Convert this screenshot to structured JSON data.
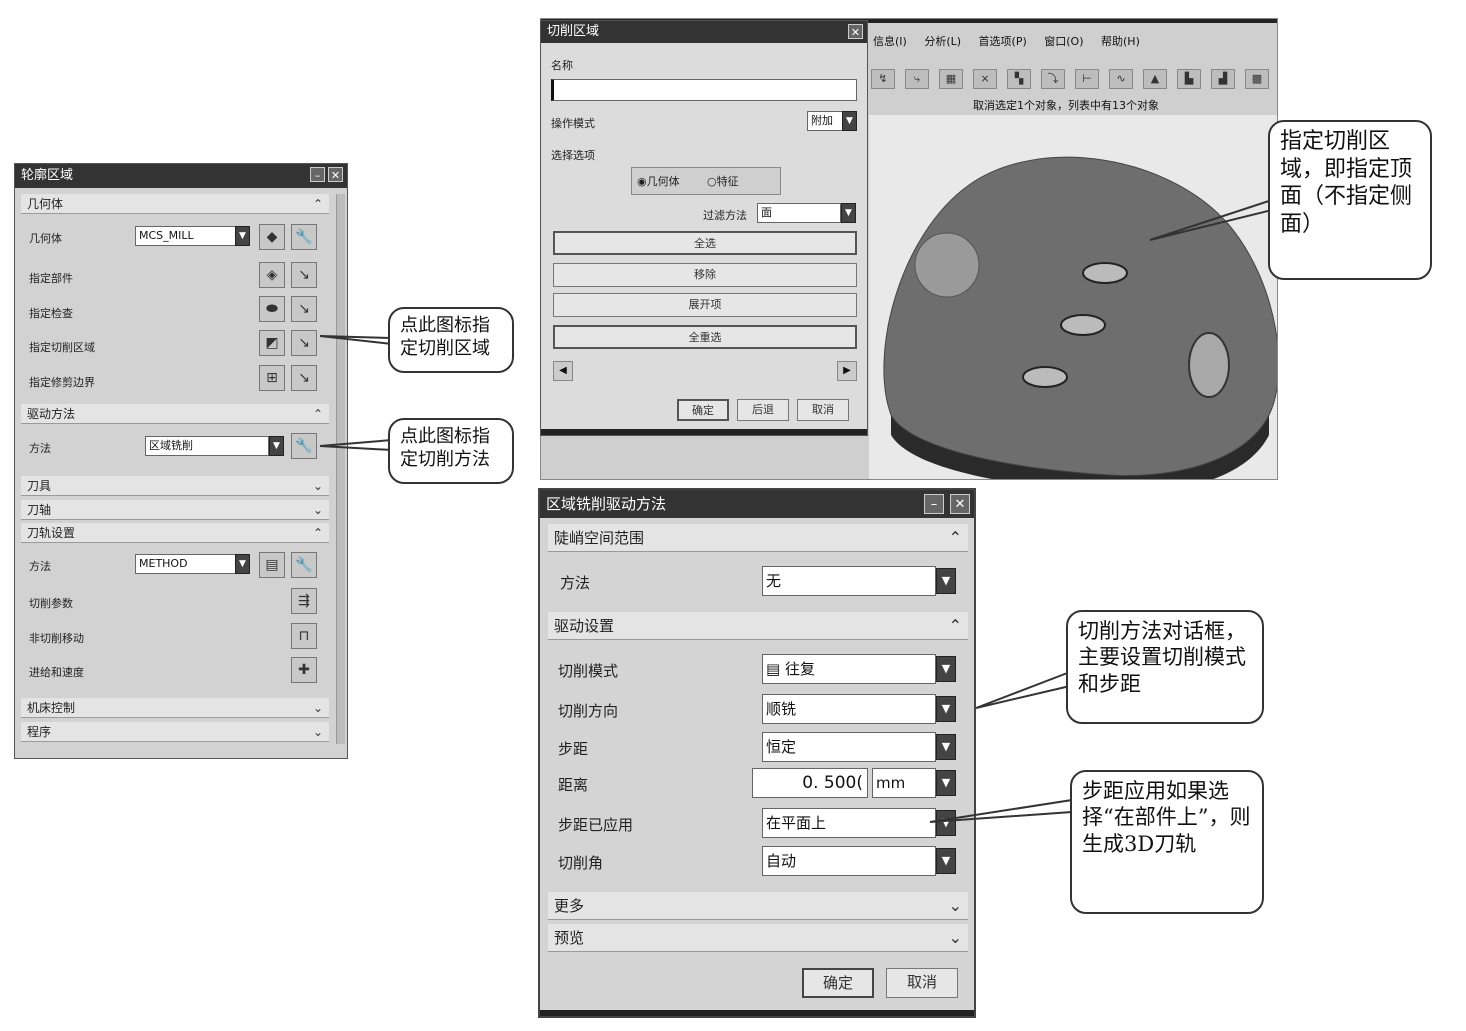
{
  "left_dialog": {
    "title": "轮廓区域",
    "geometry_section": "几何体",
    "geometry_label": "几何体",
    "geometry_value": "MCS_MILL",
    "specify_part": "指定部件",
    "specify_check": "指定检查",
    "specify_cut_area": "指定切削区域",
    "specify_trim": "指定修剪边界",
    "drive_section": "驱动方法",
    "method_label": "方法",
    "method_value": "区域铣削",
    "tool_section": "刀具",
    "axis_section": "刀轴",
    "path_section": "刀轨设置",
    "path_method_label": "方法",
    "path_method_value": "METHOD",
    "cut_params": "切削参数",
    "non_cut_moves": "非切削移动",
    "feeds_speeds": "进给和速度",
    "machine_control": "机床控制",
    "program": "程序"
  },
  "cut_area_dialog": {
    "title": "切削区域",
    "name_label": "名称",
    "name_value": "",
    "op_mode_label": "操作模式",
    "op_mode_value": "附加",
    "select_options_label": "选择选项",
    "radio_geometry": "几何体",
    "radio_feature": "特征",
    "filter_label": "过滤方法",
    "filter_value": "面",
    "btn_select_all": "全选",
    "btn_remove": "移除",
    "btn_expand": "展开项",
    "btn_reselect_all": "全重选",
    "btn_ok": "确定",
    "btn_back": "后退",
    "btn_cancel": "取消"
  },
  "app": {
    "menu": [
      "信息(I)",
      "分析(L)",
      "首选项(P)",
      "窗口(O)",
      "帮助(H)"
    ],
    "status": "取消选定1个对象，列表中有13个对象"
  },
  "drive_dialog": {
    "title": "区域铣削驱动方法",
    "steep_section": "陡峭空间范围",
    "method_label": "方法",
    "method_value": "无",
    "drive_settings_section": "驱动设置",
    "cut_mode_label": "切削模式",
    "cut_mode_value": "往复",
    "cut_dir_label": "切削方向",
    "cut_dir_value": "顺铣",
    "stepover_label": "步距",
    "stepover_value": "恒定",
    "distance_label": "距离",
    "distance_value": "0. 500(",
    "distance_unit": "mm",
    "step_applied_label": "步距已应用",
    "step_applied_value": "在平面上",
    "cut_angle_label": "切削角",
    "cut_angle_value": "自动",
    "more_section": "更多",
    "preview_section": "预览",
    "btn_ok": "确定",
    "btn_cancel": "取消"
  },
  "callouts": {
    "c1": "点此图标指定切削区域",
    "c2": "点此图标指定切削方法",
    "c3": "指定切削区域，即指定顶面（不指定侧面）",
    "c4": "切削方法对话框，主要设置切削模式和步距",
    "c5": "步距应用如果选择“在部件上”，则生成3D刀轨"
  },
  "icons": {
    "dropdown": "chevron-down-icon",
    "collapse": "chevron-up-icon",
    "close": "close-icon",
    "minimize": "minimize-icon"
  }
}
